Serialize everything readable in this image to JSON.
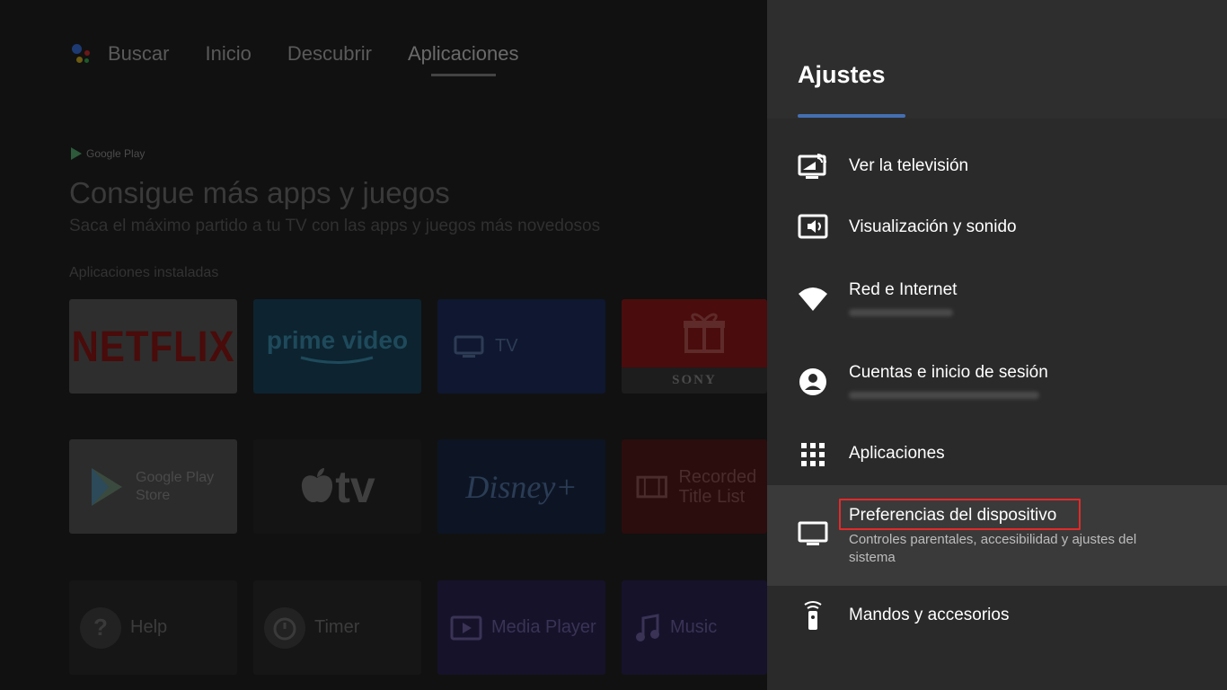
{
  "home": {
    "nav": [
      "Buscar",
      "Inicio",
      "Descubrir",
      "Aplicaciones"
    ],
    "google_play_logo": "Google Play",
    "promo_title": "Consigue más apps y juegos",
    "promo_subtitle": "Saca el máximo partido a tu TV con las apps y juegos más novedosos",
    "section_label": "Aplicaciones instaladas",
    "apps": {
      "netflix": "NETFLIX",
      "prime": "prime video",
      "tv": "TV",
      "sony": "SONY",
      "google_play_store": "Google Play Store",
      "apple_tv": "tv",
      "disney": "Disney+",
      "recorded": "Recorded Title List",
      "help": "Help",
      "timer": "Timer",
      "media_player": "Media Player",
      "music": "Music"
    }
  },
  "settings": {
    "title": "Ajustes",
    "items": [
      {
        "label": "Ver la televisión",
        "icon": "tv-input-icon"
      },
      {
        "label": "Visualización y sonido",
        "icon": "display-sound-icon"
      },
      {
        "label": "Red e Internet",
        "icon": "wifi-icon"
      },
      {
        "label": "Cuentas e inicio de sesión",
        "icon": "account-icon"
      },
      {
        "label": "Aplicaciones",
        "icon": "apps-grid-icon"
      },
      {
        "label": "Preferencias del dispositivo",
        "sublabel": "Controles parentales, accesibilidad y ajustes del sistema",
        "icon": "monitor-icon",
        "selected": true
      },
      {
        "label": "Mandos y accesorios",
        "icon": "remote-icon"
      }
    ]
  },
  "colors": {
    "panel_bg": "#2a2a2a",
    "selected_row_bg": "#3a3a3a",
    "highlight_border": "#e22a2a"
  }
}
